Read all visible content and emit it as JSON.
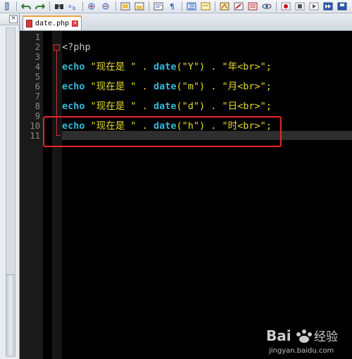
{
  "toolbar": {
    "buttons": [
      "undo-icon",
      "redo-icon",
      "find-icon",
      "replace-icon",
      "zoom-in-icon",
      "zoom-out-icon",
      "sync-vertical-icon",
      "sync-horizontal-icon",
      "wrap-icon",
      "show-all-chars-icon",
      "indent-guide-icon",
      "doc-map-icon",
      "function-list-icon",
      "folder-workspace-icon",
      "monitor-icon",
      "record-macro-icon",
      "stop-record-icon",
      "play-macro-icon",
      "run-macro-icon",
      "save-macro-icon"
    ]
  },
  "left_panel": {
    "close_label": "×"
  },
  "tab": {
    "label": "date.php"
  },
  "editor": {
    "line_numbers": [
      "1",
      "2",
      "3",
      "4",
      "5",
      "6",
      "7",
      "8",
      "9",
      "10",
      "11"
    ],
    "php_open": "<?php",
    "lines": [
      {
        "kw": "echo",
        "s1": "\"现在是 \"",
        "dot1": " . ",
        "fn": "date",
        "arg": "(\"Y\")",
        "dot2": " . ",
        "s2": "\"年<br>\";"
      },
      {
        "kw": "echo",
        "s1": "\"现在是 \"",
        "dot1": " . ",
        "fn": "date",
        "arg": "(\"m\")",
        "dot2": " . ",
        "s2": "\"月<br>\";"
      },
      {
        "kw": "echo",
        "s1": "\"现在是 \"",
        "dot1": " . ",
        "fn": "date",
        "arg": "(\"d\")",
        "dot2": " . ",
        "s2": "\"日<br>\";"
      },
      {
        "kw": "echo",
        "s1": "\"现在是 \"",
        "dot1": " . ",
        "fn": "date",
        "arg": "(\"h\")",
        "dot2": " . ",
        "s2": "\"时<br>\";"
      }
    ]
  },
  "watermark": {
    "brand": "Bai",
    "brand2": "经验",
    "url": "jingyan.baidu.com"
  },
  "colors": {
    "keyword": "#38b7d8",
    "string": "#e6d92e",
    "highlight": "#e8262b",
    "background": "#000000"
  }
}
